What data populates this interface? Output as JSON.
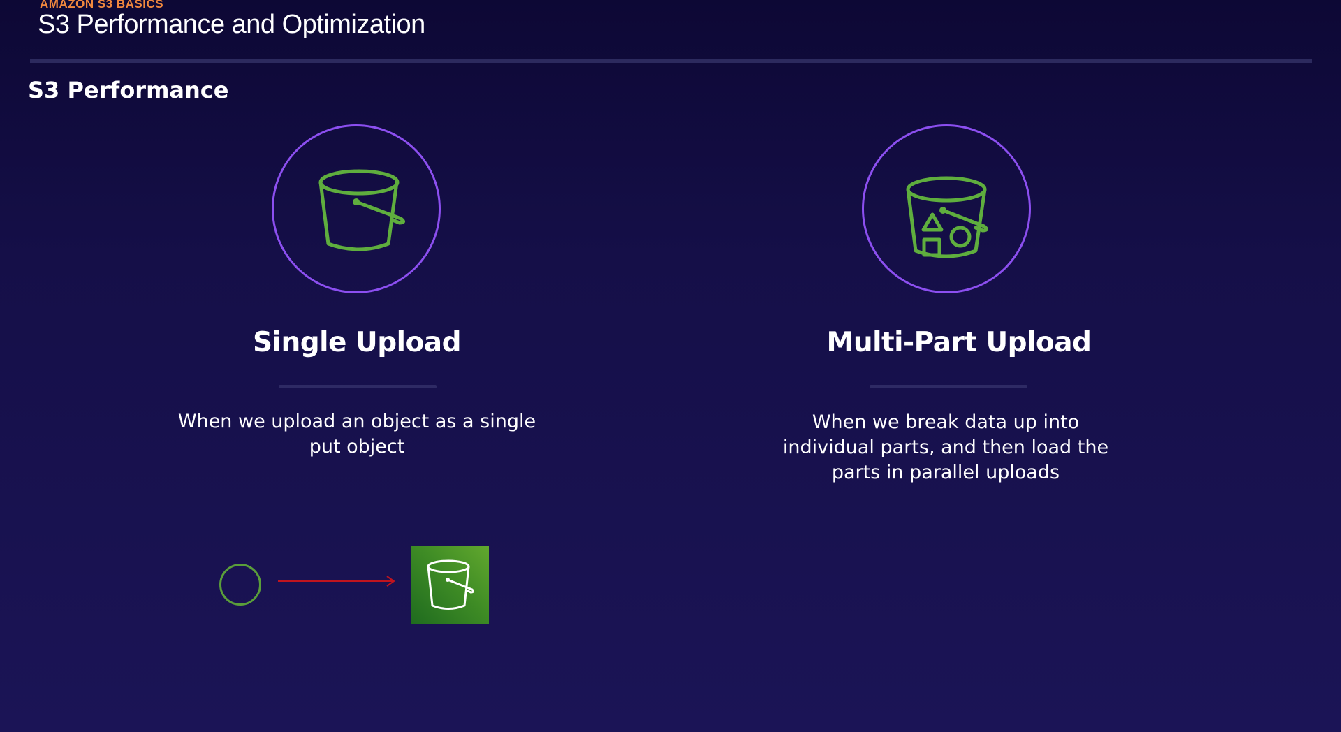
{
  "header": {
    "eyebrow": "AMAZON S3 BASICS",
    "title": "S3 Performance and Optimization"
  },
  "section": {
    "heading": "S3 Performance"
  },
  "columns": [
    {
      "title": "Single Upload",
      "description": "When we upload an object as a single put object",
      "icon": "s3-bucket-icon"
    },
    {
      "title": "Multi-Part Upload",
      "description": "When we break data up into individual parts, and then load the parts in parallel uploads",
      "icon": "s3-bucket-with-objects-icon"
    }
  ],
  "diagram": {
    "source_icon": "client-circle-icon",
    "connector_icon": "arrow-right-icon",
    "target_icon": "s3-bucket-tile-icon"
  },
  "colors": {
    "accent_orange": "#f0883e",
    "circle_purple": "#8c4ff0",
    "icon_green": "#5fae3e",
    "arrow_red": "#c0141e",
    "tile_green": "#3f8c25"
  }
}
